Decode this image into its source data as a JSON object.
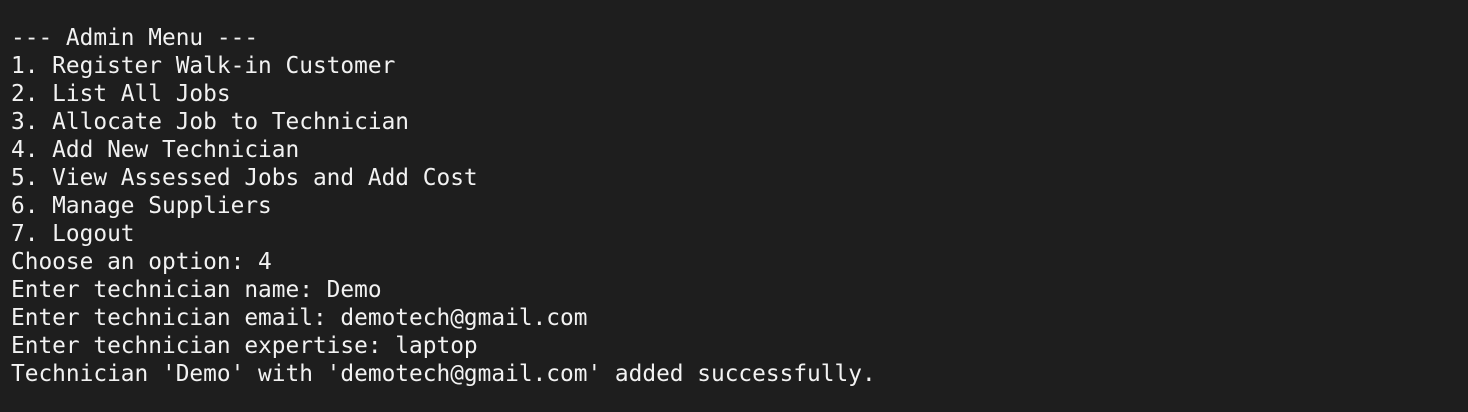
{
  "terminal": {
    "menu_header": "--- Admin Menu ---",
    "menu_items": [
      "1. Register Walk-in Customer",
      "2. List All Jobs",
      "3. Allocate Job to Technician",
      "4. Add New Technician",
      "5. View Assessed Jobs and Add Cost",
      "6. Manage Suppliers",
      "7. Logout"
    ],
    "prompts": [
      "Choose an option: 4",
      "Enter technician name: Demo",
      "Enter technician email: demotech@gmail.com",
      "Enter technician expertise: laptop"
    ],
    "result": "Technician 'Demo' with 'demotech@gmail.com' added successfully."
  },
  "colors": {
    "background": "#1e1e1e",
    "text": "#f2f2f2"
  }
}
